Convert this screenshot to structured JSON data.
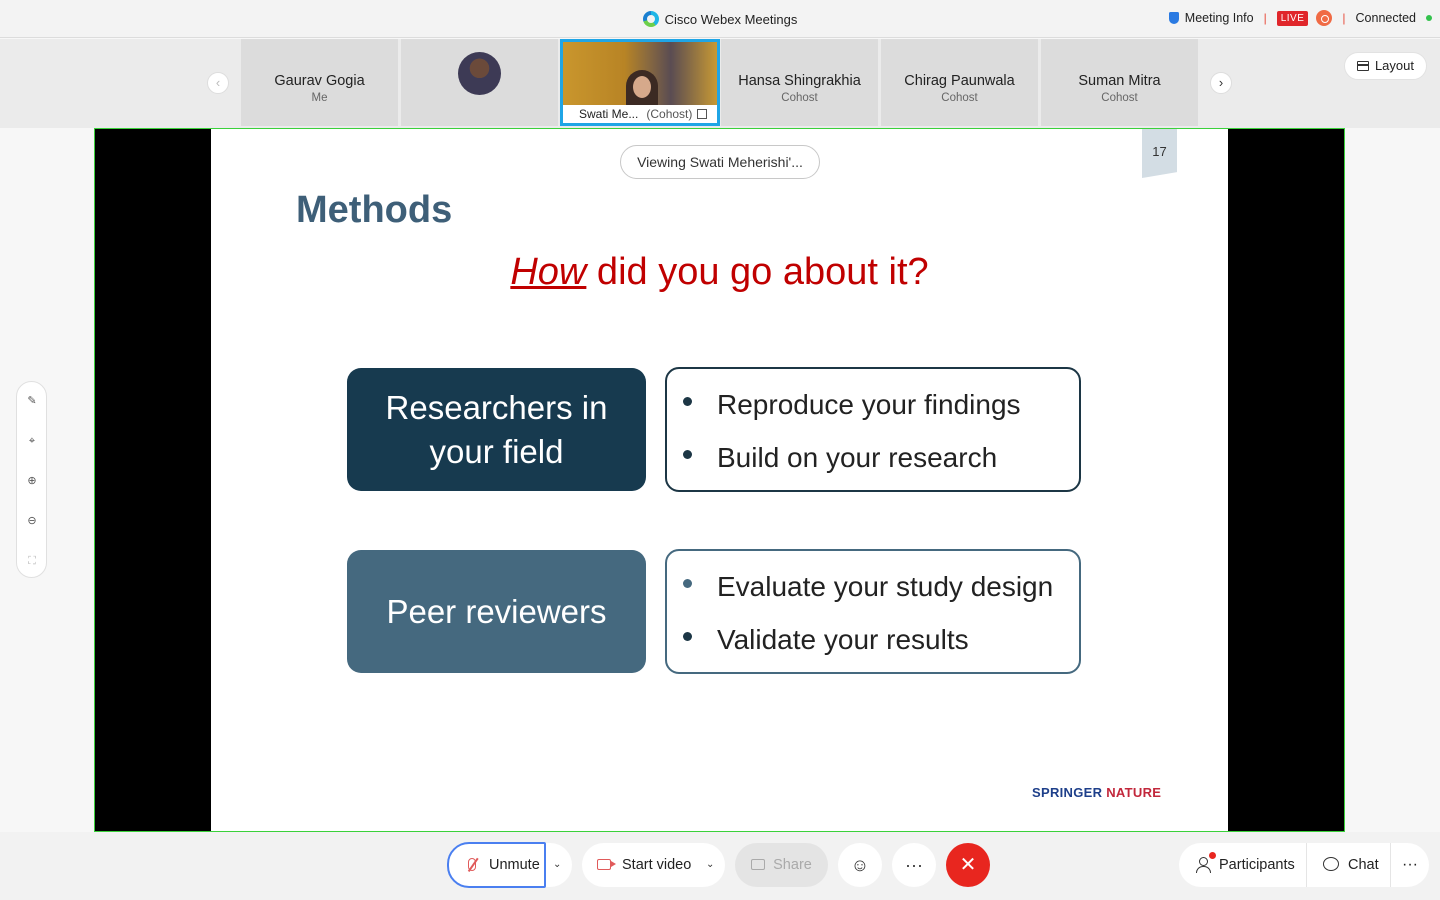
{
  "window": {
    "title": "Cisco Webex Meetings",
    "meeting_info": "Meeting Info",
    "live_badge": "LIVE",
    "status": "Connected"
  },
  "participants": {
    "tiles": [
      {
        "name": "Gaurav Gogia",
        "role": "Me"
      },
      {
        "name": "",
        "role": ""
      },
      {
        "name": "Swati Me...",
        "role": "(Cohost)"
      },
      {
        "name": "Hansa Shingrakhia",
        "role": "Cohost"
      },
      {
        "name": "Chirag Paunwala",
        "role": "Cohost"
      },
      {
        "name": "Suman Mitra",
        "role": "Cohost"
      }
    ],
    "layout_label": "Layout"
  },
  "stage": {
    "viewing_label": "Viewing Swati Meherishi'...",
    "page_number": "17",
    "slide": {
      "heading": "Methods",
      "question_emph": "How",
      "question_rest": " did you go about it?",
      "rows": [
        {
          "role": "Researchers in your field",
          "bullets": [
            "Reproduce your findings",
            "Build on your research"
          ]
        },
        {
          "role": "Peer reviewers",
          "bullets": [
            "Evaluate your study design",
            "Validate your results"
          ]
        }
      ],
      "brand_a": "SPRINGER",
      "brand_b": "NATURE"
    }
  },
  "side_tools": [
    "annotate-icon",
    "highlighter-icon",
    "zoom-in-icon",
    "zoom-out-icon",
    "fit-screen-icon"
  ],
  "toolbar": {
    "unmute_label": "Unmute",
    "start_video_label": "Start video",
    "share_label": "Share",
    "participants_label": "Participants",
    "chat_label": "Chat",
    "more_glyph": "···",
    "leave_glyph": "✕",
    "emoji_glyph": "☺"
  },
  "colors": {
    "accent": "#1fa5e6",
    "stage_border": "#3bd13b",
    "leave": "#e8261f",
    "live": "#e0262b",
    "heading": "#3e5f78",
    "question": "#c00000",
    "box_dark": "#173a4f",
    "box_light": "#45697f"
  }
}
